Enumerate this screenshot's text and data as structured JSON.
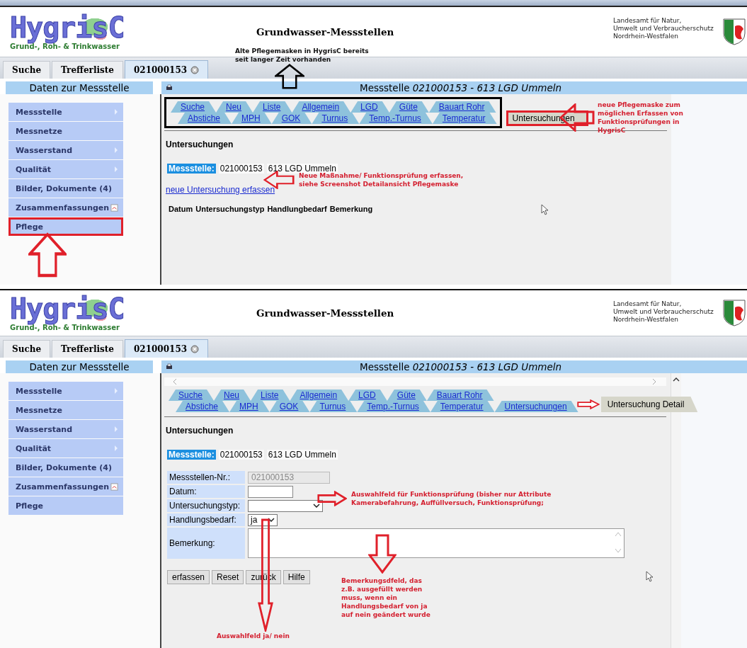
{
  "screens": [
    {
      "logo": {
        "name": "HygrisC",
        "tagline": "Grund-, Roh- & Trinkwasser"
      },
      "title": "Grundwasser-Messstellen",
      "agency": [
        "Landesamt für Natur,",
        "Umwelt und Verbraucherschutz",
        "Nordrhein-Westfalen"
      ],
      "tabs": [
        {
          "label": "Suche",
          "selected": false,
          "closable": false
        },
        {
          "label": "Trefferliste",
          "selected": false,
          "closable": false
        },
        {
          "label": "021000153",
          "selected": true,
          "closable": true
        }
      ],
      "sidebar": {
        "title": "Daten zur Messstelle",
        "items": [
          {
            "label": "Messstelle",
            "submenu": true,
            "pdf": false,
            "highlighted": false
          },
          {
            "label": "Messnetze",
            "submenu": false,
            "pdf": false,
            "highlighted": false
          },
          {
            "label": "Wasserstand",
            "submenu": true,
            "pdf": false,
            "highlighted": false
          },
          {
            "label": "Qualität",
            "submenu": true,
            "pdf": false,
            "highlighted": false
          },
          {
            "label": "Bilder, Dokumente (4)",
            "submenu": false,
            "pdf": false,
            "highlighted": false
          },
          {
            "label": "Zusammenfassungen",
            "submenu": false,
            "pdf": true,
            "highlighted": false
          },
          {
            "label": "Pflege",
            "submenu": false,
            "pdf": false,
            "highlighted": true
          }
        ]
      },
      "content_title": "Messstelle *021000153 - 613 LGD Ummeln*",
      "nav": {
        "framed": true,
        "scrollable": false,
        "current_highlighted": true,
        "top_row": [
          {
            "label": "Suche",
            "selected": false
          },
          {
            "label": "Neu",
            "selected": false
          },
          {
            "label": "Liste",
            "selected": false
          },
          {
            "label": "Allgemein",
            "selected": false
          },
          {
            "label": "LGD",
            "selected": false
          },
          {
            "label": "Güte",
            "selected": false
          },
          {
            "label": "Bauart Rohr",
            "selected": false
          }
        ],
        "bottom_row": [
          {
            "label": "Abstiche",
            "selected": false
          },
          {
            "label": "MPH",
            "selected": false
          },
          {
            "label": "GOK",
            "selected": false
          },
          {
            "label": "Turnus",
            "selected": false
          },
          {
            "label": "Temp.-Turnus",
            "selected": false
          },
          {
            "label": "Temperatur",
            "selected": false
          },
          {
            "label": "Untersuchungen",
            "selected": true
          }
        ]
      },
      "section_title": "Untersuchungen",
      "station": {
        "label": "Messstelle:",
        "number": "021000153",
        "name": "613 LGD Ummeln"
      },
      "new_link": "neue Untersuchung erfassen",
      "columns": [
        "Datum",
        "Untersuchungstyp",
        "Handlungbedarf",
        "Bemerkung"
      ],
      "annotations": [
        {
          "kind": "header-note",
          "lines": [
            "Alte Pflegemasken in HygrisC bereits",
            "seit langer Zeit vorhanden"
          ]
        },
        {
          "kind": "nav-note",
          "lines": [
            "neue Pflegemaske zum",
            "möglichen Erfassen von",
            "Funktionsprüfungen in",
            "HygrisC"
          ]
        },
        {
          "kind": "link-note",
          "lines": [
            "Neue Maßnahme/ Funktionsprüfung erfassen,",
            "siehe Screenshot Detailansicht Pflegemaske"
          ]
        },
        {
          "kind": "sidebar-arrow"
        }
      ]
    },
    {
      "logo": {
        "name": "HygrisC",
        "tagline": "Grund-, Roh- & Trinkwasser"
      },
      "title": "Grundwasser-Messstellen",
      "agency": [
        "Landesamt für Natur,",
        "Umwelt und Verbraucherschutz",
        "Nordrhein-Westfalen"
      ],
      "tabs": [
        {
          "label": "Suche",
          "selected": false,
          "closable": false
        },
        {
          "label": "Trefferliste",
          "selected": false,
          "closable": false
        },
        {
          "label": "021000153",
          "selected": true,
          "closable": true
        }
      ],
      "sidebar": {
        "title": "Daten zur Messstelle",
        "items": [
          {
            "label": "Messstelle",
            "submenu": true,
            "pdf": false,
            "highlighted": false
          },
          {
            "label": "Messnetze",
            "submenu": false,
            "pdf": false,
            "highlighted": false
          },
          {
            "label": "Wasserstand",
            "submenu": true,
            "pdf": false,
            "highlighted": false
          },
          {
            "label": "Qualität",
            "submenu": true,
            "pdf": false,
            "highlighted": false
          },
          {
            "label": "Bilder, Dokumente (4)",
            "submenu": false,
            "pdf": false,
            "highlighted": false
          },
          {
            "label": "Zusammenfassungen",
            "submenu": false,
            "pdf": true,
            "highlighted": false
          },
          {
            "label": "Pflege",
            "submenu": false,
            "pdf": false,
            "highlighted": false
          }
        ]
      },
      "content_title": "Messstelle *021000153 - 613 LGD Ummeln*",
      "nav": {
        "framed": false,
        "scrollable": true,
        "current_highlighted": false,
        "top_row": [
          {
            "label": "Suche",
            "selected": false
          },
          {
            "label": "Neu",
            "selected": false
          },
          {
            "label": "Liste",
            "selected": false
          },
          {
            "label": "Allgemein",
            "selected": false
          },
          {
            "label": "LGD",
            "selected": false
          },
          {
            "label": "Güte",
            "selected": false
          },
          {
            "label": "Bauart Rohr",
            "selected": false
          }
        ],
        "bottom_row": [
          {
            "label": "Abstiche",
            "selected": false
          },
          {
            "label": "MPH",
            "selected": false
          },
          {
            "label": "GOK",
            "selected": false
          },
          {
            "label": "Turnus",
            "selected": false
          },
          {
            "label": "Temp.-Turnus",
            "selected": false
          },
          {
            "label": "Temperatur",
            "selected": false
          },
          {
            "label": "Untersuchungen",
            "selected": false
          },
          {
            "label": "Untersuchung Detail",
            "selected": true
          }
        ]
      },
      "section_title": "Untersuchungen",
      "station": {
        "label": "Messstelle:",
        "number": "021000153",
        "name": "613 LGD Ummeln"
      },
      "form": {
        "fields": [
          {
            "kind": "readonly",
            "label": "Messstellen-Nr.:",
            "value": "021000153"
          },
          {
            "kind": "date",
            "label": "Datum:"
          },
          {
            "kind": "select",
            "label": "Untersuchungstyp:"
          },
          {
            "kind": "choice",
            "label": "Handlungsbedarf:",
            "value": "ja"
          },
          {
            "kind": "textarea",
            "label": "Bemerkung:"
          }
        ],
        "buttons": [
          "erfassen",
          "Reset",
          "zurück",
          "Hilfe"
        ]
      },
      "annotations": [
        {
          "kind": "tab-arrow"
        },
        {
          "kind": "type-note",
          "lines": [
            "Auswahlfeld für Funktionsprüfung (bisher nur Attribute",
            "Kamerabefahrung, Auffüllversuch, Funktionsprüfung;"
          ]
        },
        {
          "kind": "remark-note",
          "lines": [
            "Bemerkungsdfeld, das",
            "z.B. ausgefüllt werden",
            "muss, wenn ein",
            "Handlungsbedarf von ja",
            "auf nein geändert wurde"
          ]
        },
        {
          "kind": "choice-note",
          "lines": [
            "Auswahlfeld ja/ nein"
          ]
        }
      ]
    }
  ]
}
